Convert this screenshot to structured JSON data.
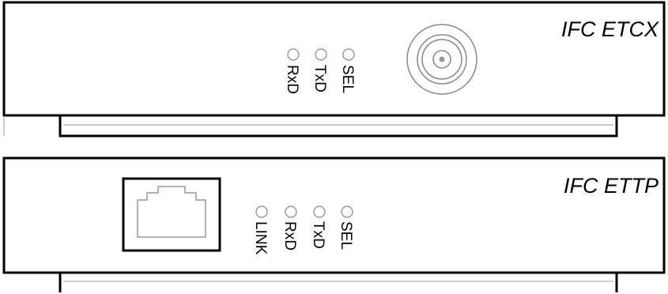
{
  "modules": [
    {
      "model": "IFC ETCX",
      "port": "coax-connector",
      "leds": [
        "RxD",
        "TxD",
        "SEL"
      ]
    },
    {
      "model": "IFC ETTP",
      "port": "rj45-connector",
      "leds": [
        "LINK",
        "RxD",
        "TxD",
        "SEL"
      ]
    }
  ],
  "colors": {
    "line": "#000000",
    "panel": "#ffffff",
    "port_outline": "#999999"
  }
}
